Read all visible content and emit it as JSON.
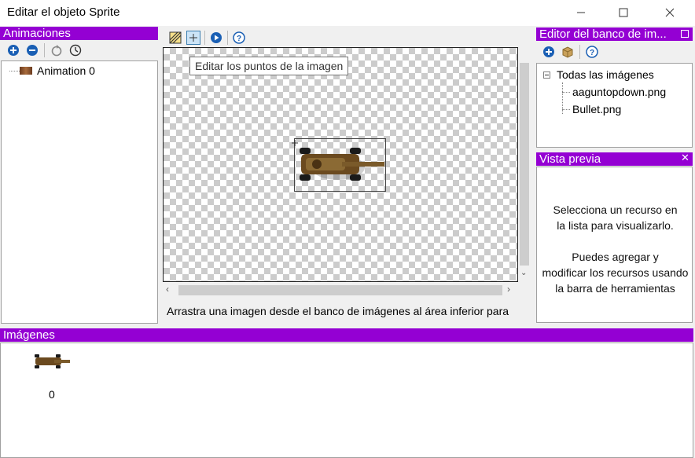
{
  "window": {
    "title": "Editar el objeto Sprite"
  },
  "animations_panel": {
    "title": "Animaciones",
    "items": [
      {
        "label": "Animation 0"
      }
    ]
  },
  "editor": {
    "tooltip": "Editar los puntos de la imagen",
    "hint": "Arrastra una imagen desde el banco de imágenes al área inferior para"
  },
  "image_bank": {
    "title": "Editor del banco de im...",
    "root_label": "Todas las imágenes",
    "files": [
      {
        "label": "aaguntopdown.png"
      },
      {
        "label": "Bullet.png"
      }
    ]
  },
  "preview": {
    "title": "Vista previa",
    "line1": "Selecciona un recurso en",
    "line2": "la lista para visualizarlo.",
    "line3": "Puedes agregar y",
    "line4": "modificar los recursos usando",
    "line5": "la barra de herramientas"
  },
  "images_panel": {
    "title": "Imágenes",
    "frames": [
      {
        "index": "0"
      }
    ]
  },
  "colors": {
    "header_purple": "#9400d3",
    "accent_blue": "#1a5fb4"
  }
}
